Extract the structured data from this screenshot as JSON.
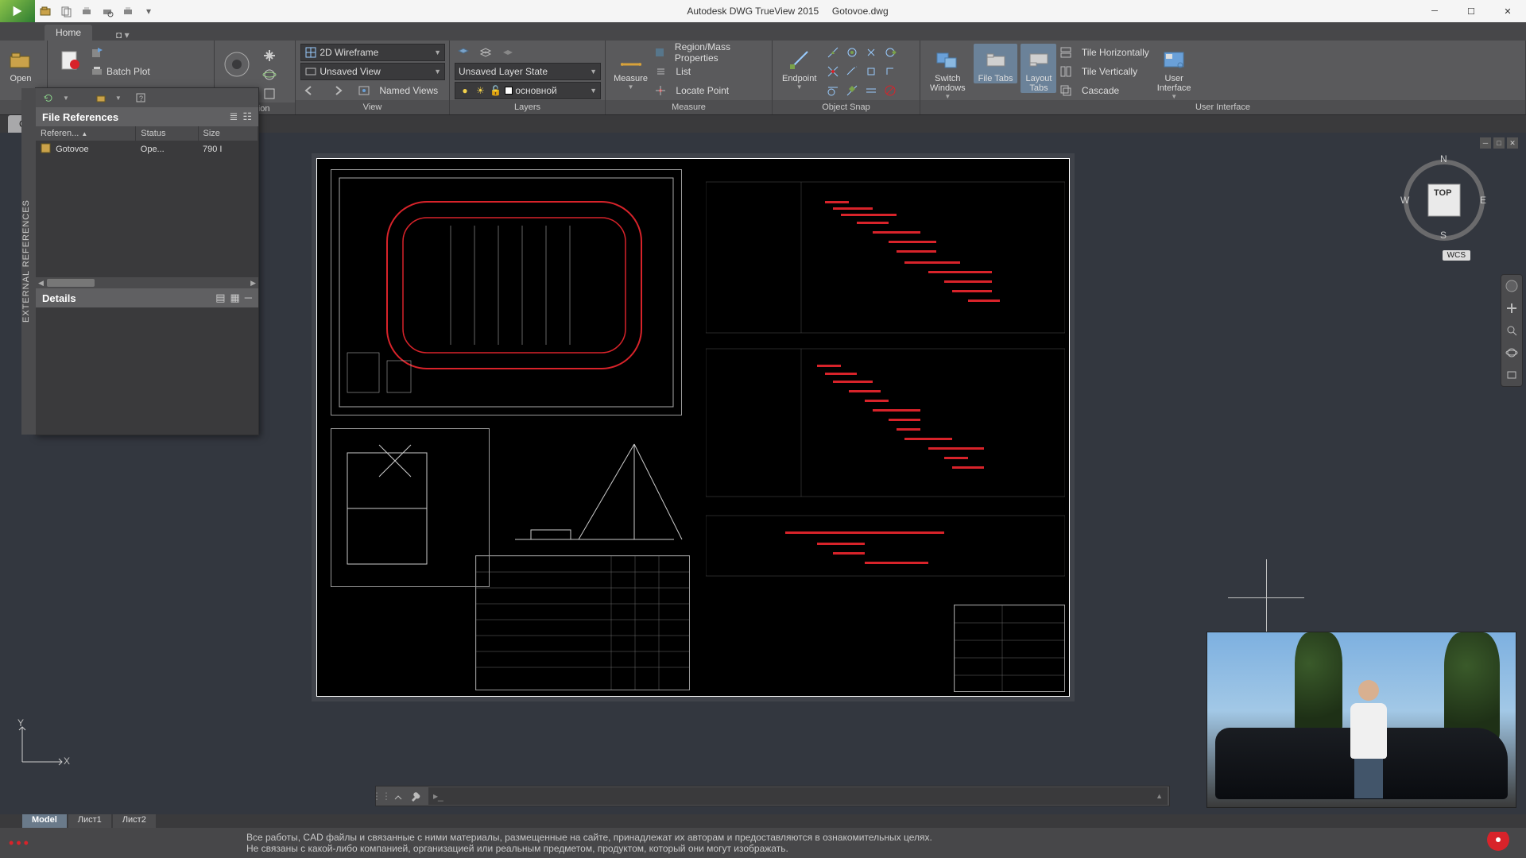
{
  "app": {
    "name": "Autodesk DWG TrueView 2015",
    "file": "Gotovoe.dwg"
  },
  "quick_access": [
    "open",
    "save",
    "plot",
    "plot-preview",
    "undo",
    "dropdown"
  ],
  "tabs": {
    "home": "Home"
  },
  "ribbon": {
    "open_label": "Open",
    "batch_plot": "Batch Plot",
    "navigation": "vigation",
    "view": {
      "title": "View",
      "visual_style": "2D Wireframe",
      "named_view": "Unsaved View",
      "named_views": "Named Views"
    },
    "layers": {
      "title": "Layers",
      "layer_state": "Unsaved Layer State",
      "current_layer": "основной"
    },
    "measure": {
      "title": "Measure",
      "btn": "Measure",
      "region": "Region/Mass Properties",
      "list": "List",
      "locate": "Locate Point"
    },
    "osnap": {
      "title": "Object Snap",
      "btn": "Endpoint"
    },
    "ui": {
      "title": "User Interface",
      "switch_windows": "Switch\nWindows",
      "file_tabs": "File Tabs",
      "layout_tabs": "Layout\nTabs",
      "tile_h": "Tile Horizontally",
      "tile_v": "Tile Vertically",
      "cascade": "Cascade",
      "interface": "User\nInterface"
    }
  },
  "doc_tabs": {
    "current": "Gotovoe"
  },
  "palette": {
    "side_title": "EXTERNAL REFERENCES",
    "refs_title": "File References",
    "cols": {
      "ref": "Referen...",
      "status": "Status",
      "size": "Size"
    },
    "row": {
      "name": "Gotovoe",
      "status": "Ope...",
      "size": "790 I"
    },
    "details_title": "Details"
  },
  "nav": {
    "cube_top": "TOP",
    "wcs": "WCS",
    "n": "N",
    "e": "E",
    "s": "S",
    "w": "W"
  },
  "layout_tabs": {
    "model": "Model",
    "l1": "Лист1",
    "l2": "Лист2"
  },
  "footer": {
    "line1": "Все работы, CAD файлы и связанные с ними материалы, размещенные на сайте, принадлежат их авторам и предоставляются в ознакомительных целях.",
    "line2": "Не связаны с какой-либо компанией, организацией или реальным предметом, продуктом, который они могут изображать."
  },
  "ucs": {
    "x": "X",
    "y": "Y"
  }
}
